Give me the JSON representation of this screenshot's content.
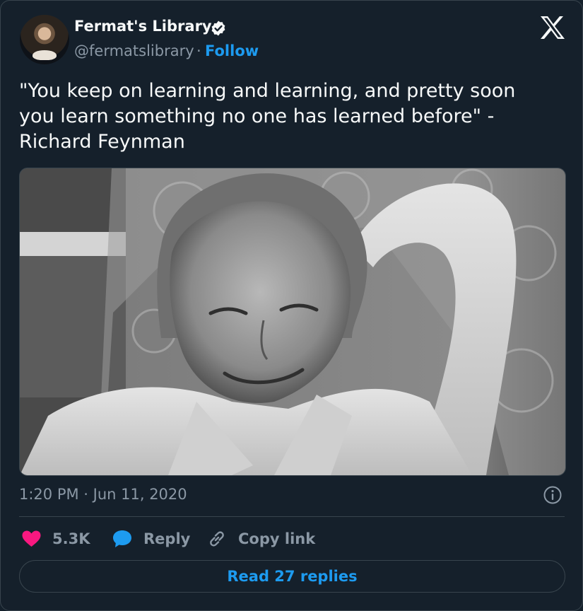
{
  "author": {
    "name": "Fermat's Library",
    "handle": "@fermatslibrary",
    "separator": "·",
    "follow_label": "Follow",
    "verified": true
  },
  "tweet": {
    "text_line1": "\"You keep on learning and learning, and pretty soon",
    "text_line2": "you learn something no one has learned before\" -",
    "text_line3": "Richard Feynman",
    "timestamp": "1:20 PM · Jun 11, 2020"
  },
  "actions": {
    "likes_count": "5.3K",
    "reply_label": "Reply",
    "copy_link_label": "Copy link"
  },
  "read_replies_label": "Read 27 replies",
  "icons": {
    "brand": "x-logo-icon",
    "verified": "verified-badge-icon",
    "info": "info-icon",
    "like": "heart-icon",
    "reply": "speech-bubble-icon",
    "copy": "link-icon"
  },
  "colors": {
    "background": "#15202b",
    "accent": "#1d9bf0",
    "like": "#f91880",
    "muted": "#8b98a5",
    "text": "#f7f9f9"
  }
}
